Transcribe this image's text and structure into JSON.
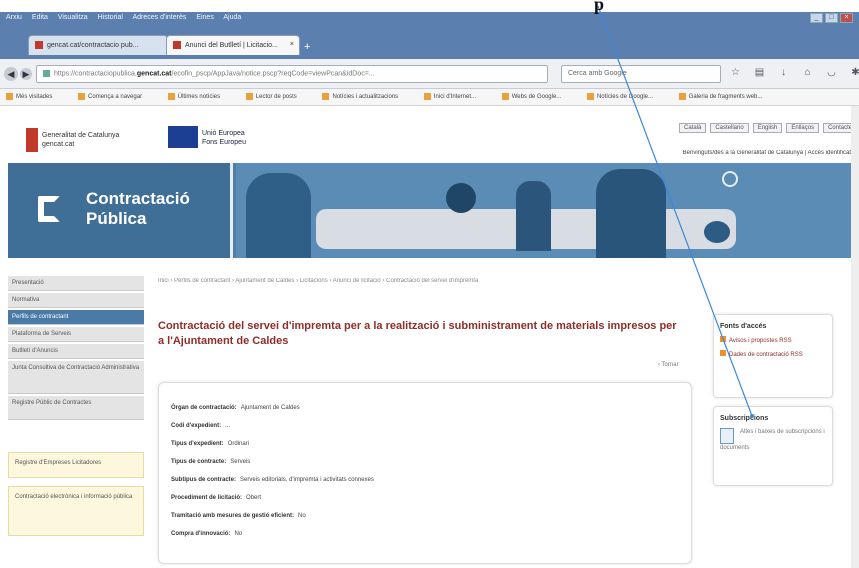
{
  "window": {
    "menu": [
      "Arxiu",
      "Edita",
      "Visualitza",
      "Historial",
      "Adreces d'interès",
      "Eines",
      "Ajuda"
    ],
    "controls": [
      "_",
      "□",
      "×"
    ]
  },
  "tabs": [
    {
      "label": "gencat.cat/contractacio pub..."
    },
    {
      "label": "Anunci del Butlletí | Licitacio..."
    }
  ],
  "navbar": {
    "url_prefix": "https://contractaciopublica.",
    "url_host": "gencat.cat",
    "url_rest": "/ecofin_pscp/AppJava/notice.pscp?reqCode=viewPcan&idDoc=...",
    "search_placeholder": "Cerca amb Google"
  },
  "bookmarks": [
    "Més visitades",
    "Comença a navegar",
    "Últimes notícies",
    "Lector de posts",
    "Notícies i actualitzacions",
    "Inici d'Internet...",
    "Webs de Google...",
    "Notícies de Google...",
    "Galeria de fragments web..."
  ],
  "header": {
    "gene_logo": "Generalitat de Catalunya\ngencat.cat",
    "eu_logo": "Unió Europea\nFons Europeu",
    "utility_links": [
      "Català",
      "Castellano",
      "English",
      "Enllaços",
      "Contacte"
    ],
    "welcome": "Benvinguts/des a la Generalitat de Catalunya | Accés identificat"
  },
  "banner": {
    "title_line1": "Contractació",
    "title_line2": "Pública"
  },
  "sidenav": {
    "items": [
      "Presentació",
      "Normativa",
      "Perfils de contractant",
      "Plataforma de Serveis",
      "Butlletí d'Anuncis",
      "Junta Consultiva de Contractació Administrativa",
      "Registre Públic de Contractes"
    ],
    "boxes": [
      "Registre d'Empreses Licitadores",
      "Contractació electrònica i informació pública"
    ]
  },
  "main": {
    "breadcrumb": "Inici › Perfils de contractant › Ajuntament de Caldes › Licitacions › Anunci de licitació › Contractació del servei d'impremta",
    "title": "Contractació del servei d'impremta per a la realització i subministrament de materials impresos per a l'Ajuntament de Caldes",
    "back_link": "‹ Tornar",
    "fields": [
      {
        "label": "Òrgan de contractació:",
        "value": "Ajuntament de Caldes"
      },
      {
        "label": "Codi d'expedient:",
        "value": "..."
      },
      {
        "label": "Tipus d'expedient:",
        "value": "Ordinari"
      },
      {
        "label": "Tipus de contracte:",
        "value": "Serveis"
      },
      {
        "label": "Subtipus de contracte:",
        "value": "Serveis editorials, d'impremta i activitats connexes"
      },
      {
        "label": "Procediment de licitació:",
        "value": "Obert"
      },
      {
        "label": "Tramitació amb mesures de gestió eficient:",
        "value": "No"
      },
      {
        "label": "Compra d'innovació:",
        "value": "No"
      }
    ]
  },
  "right": {
    "access_title": "Fonts d'accés",
    "access_links": [
      "Avisos i propostes RSS",
      "Dades de contractació RSS"
    ],
    "subs_title": "Subscripcions",
    "subs_text": "Altes i baixes de subscripcions i documents"
  },
  "annotation": {
    "label": "p"
  }
}
